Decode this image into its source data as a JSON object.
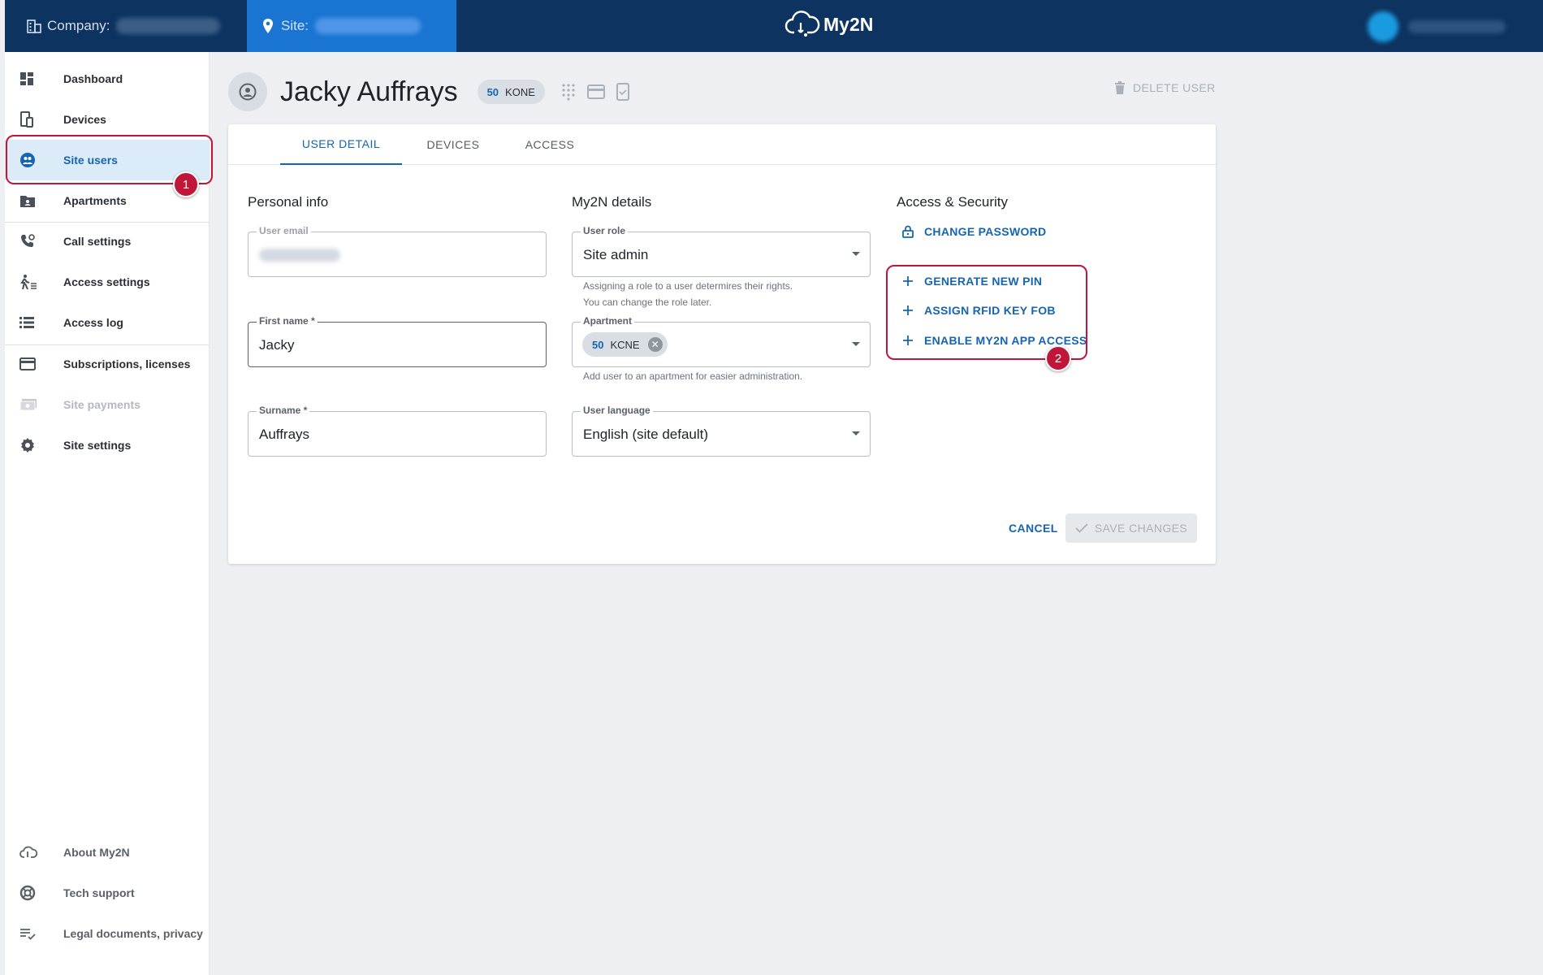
{
  "topbar": {
    "company_label": "Company:",
    "site_label": "Site:",
    "logo_text": "My2N"
  },
  "sidebar": {
    "items": [
      {
        "label": "Dashboard",
        "icon": "dashboard-icon"
      },
      {
        "label": "Devices",
        "icon": "devices-icon"
      },
      {
        "label": "Site users",
        "icon": "site-users-icon",
        "active": true
      },
      {
        "label": "Apartments",
        "icon": "apartments-icon"
      },
      {
        "label": "Call settings",
        "icon": "call-settings-icon"
      },
      {
        "label": "Access settings",
        "icon": "access-settings-icon"
      },
      {
        "label": "Access log",
        "icon": "access-log-icon"
      },
      {
        "label": "Subscriptions, licenses",
        "icon": "subscriptions-icon"
      },
      {
        "label": "Site payments",
        "icon": "site-payments-icon",
        "disabled": true
      },
      {
        "label": "Site settings",
        "icon": "site-settings-icon"
      }
    ],
    "footer_items": [
      {
        "label": "About My2N",
        "icon": "cloud-icon"
      },
      {
        "label": "Tech support",
        "icon": "lifebuoy-icon"
      },
      {
        "label": "Legal documents, privacy",
        "icon": "legal-icon"
      }
    ]
  },
  "header": {
    "user_name": "Jacky Auffrays",
    "chip_number": "50",
    "chip_text": "KONE",
    "delete_label": "DELETE USER"
  },
  "tabs": [
    {
      "label": "USER DETAIL",
      "active": true
    },
    {
      "label": "DEVICES"
    },
    {
      "label": "ACCESS"
    }
  ],
  "personal_info": {
    "title": "Personal info",
    "email_label": "User email",
    "first_name_label": "First name *",
    "first_name_value": "Jacky",
    "surname_label": "Surname *",
    "surname_value": "Auffrays"
  },
  "my2n_details": {
    "title": "My2N details",
    "role_label": "User role",
    "role_value": "Site admin",
    "role_help_1": "Assigning a role to a user determires their rights.",
    "role_help_2": "You can change the role later.",
    "apartment_label": "Apartment",
    "apartment_chip_number": "50",
    "apartment_chip_text": "KCNE",
    "apartment_help": "Add user to an apartment for easier administration.",
    "language_label": "User language",
    "language_value": "English (site default)"
  },
  "access_security": {
    "title": "Access & Security",
    "change_password": "CHANGE PASSWORD",
    "generate_pin": "GENERATE NEW PIN",
    "assign_rfid": "ASSIGN RFID KEY FOB",
    "enable_app": "ENABLE MY2N APP ACCESS"
  },
  "actions": {
    "cancel": "CANCEL",
    "save": "SAVE CHANGES"
  },
  "annotations": {
    "marker_1": "1",
    "marker_2": "2",
    "highlight_color": "#c0163a"
  },
  "colors": {
    "topbar": "#0d3360",
    "site_tab": "#1a74d2",
    "accent": "#1665b0",
    "active_nav_bg": "#dcebf8"
  }
}
